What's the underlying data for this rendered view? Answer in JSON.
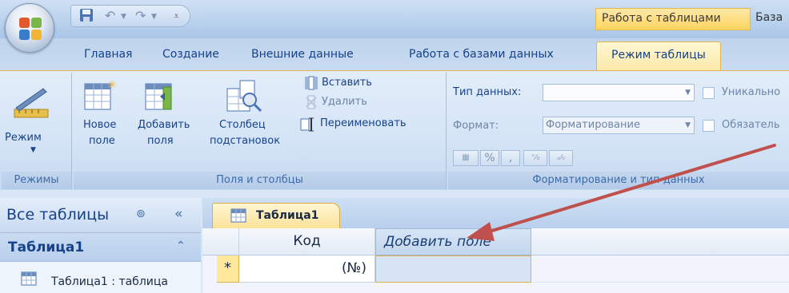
{
  "title_bar": {
    "context_tab_label": "Работа с таблицами",
    "window_title": "База",
    "qat": {
      "save_icon": "save-icon",
      "undo_icon": "undo-icon",
      "redo_icon": "redo-icon"
    }
  },
  "tabs": [
    {
      "label": "Главная"
    },
    {
      "label": "Создание"
    },
    {
      "label": "Внешние данные"
    },
    {
      "label": "Работа с базами данных"
    },
    {
      "label": "Режим таблицы",
      "active": true
    }
  ],
  "ribbon": {
    "groups": {
      "modes": {
        "label": "Режимы",
        "mode_button": "Режим"
      },
      "fields": {
        "label": "Поля и столбцы",
        "new_field": [
          "Новое",
          "поле"
        ],
        "add_fields": [
          "Добавить",
          "поля"
        ],
        "lookup_column": [
          "Столбец",
          "подстановок"
        ],
        "insert": "Вставить",
        "delete": "Удалить",
        "rename": "Переименовать"
      },
      "formatting": {
        "label": "Форматирование и тип данных",
        "data_type_label": "Тип данных:",
        "data_type_value": "",
        "format_label": "Формат:",
        "format_placeholder": "Форматирование",
        "unique_label": "Уникально",
        "required_label": "Обязатель",
        "percent_label": "%",
        "comma_label": ",",
        "increase_decimal": "+,0 ,00",
        "decrease_decimal": ",00 ,0"
      }
    }
  },
  "nav_pane": {
    "title": "Все таблицы",
    "section_title": "Таблица1",
    "items": [
      {
        "label": "Таблица1 : таблица"
      }
    ]
  },
  "document": {
    "tab_label": "Таблица1",
    "columns": [
      {
        "label": "Код"
      },
      {
        "label": "Добавить поле"
      }
    ],
    "new_row": {
      "marker": "*",
      "kod_value": "(№)"
    }
  },
  "colors": {
    "arrow": "#c0504d",
    "accent": "#fbe29a",
    "ribbon_text": "#15428b"
  }
}
